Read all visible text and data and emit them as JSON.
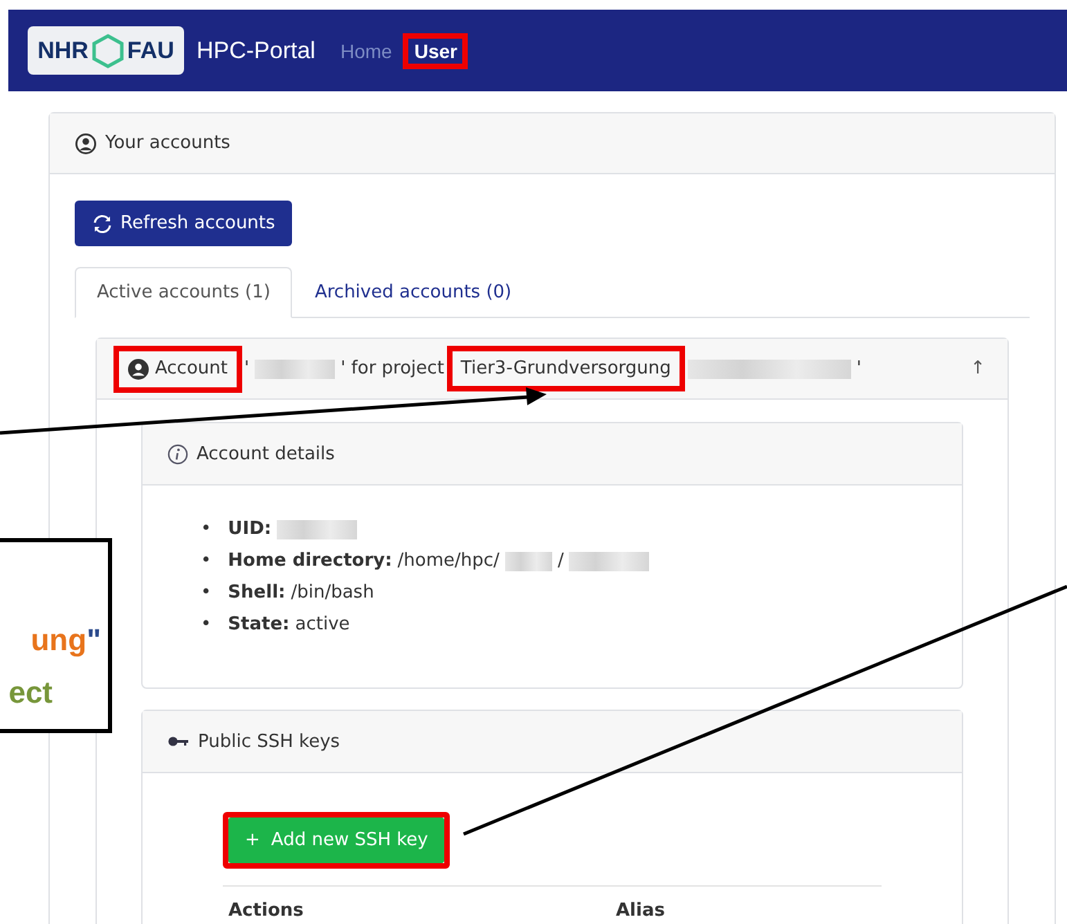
{
  "navbar": {
    "logo": {
      "left": "NHR",
      "right": "FAU"
    },
    "brand": "HPC-Portal",
    "links": [
      {
        "label": "Home",
        "selected": false,
        "kind": "link"
      },
      {
        "label": "User",
        "selected": true,
        "kind": "boxed"
      }
    ]
  },
  "accounts_card": {
    "title": "Your accounts",
    "refresh_button": "Refresh accounts",
    "tabs": [
      {
        "label": "Active accounts (1)",
        "selected": true
      },
      {
        "label": "Archived accounts (0)",
        "selected": false
      }
    ],
    "account": {
      "header": [
        {
          "kind": "boxed",
          "text": "Account"
        },
        {
          "kind": "text",
          "text": "'"
        },
        {
          "kind": "blur"
        },
        {
          "kind": "text",
          "text": "' for project"
        },
        {
          "kind": "boxed",
          "text": "Tier3-Grundversorgung"
        },
        {
          "kind": "blur"
        },
        {
          "kind": "text",
          "text": "'"
        }
      ],
      "toggle": "↑",
      "details": {
        "title": "Account details",
        "items": [
          {
            "bullet": "•",
            "label": "UID:",
            "value": [
              {
                "kind": "blur"
              }
            ]
          },
          {
            "bullet": "•",
            "label": "Home directory:",
            "value": [
              {
                "kind": "text",
                "text": "/home/hpc/"
              },
              {
                "kind": "blur"
              },
              {
                "kind": "text",
                "text": "/"
              },
              {
                "kind": "blur"
              }
            ]
          },
          {
            "bullet": "•",
            "label": "Shell:",
            "value": [
              {
                "kind": "text",
                "text": "/bin/bash"
              }
            ]
          },
          {
            "bullet": "•",
            "label": "State:",
            "value": [
              {
                "kind": "text",
                "text": "active"
              }
            ]
          }
        ]
      },
      "ssh_keys": {
        "title": "Public SSH keys",
        "add_button": {
          "icon": "+",
          "label": "Add new SSH key",
          "highlighted": true
        },
        "columns": [
          "Actions",
          "Alias"
        ]
      }
    }
  },
  "callout": {
    "lines": [
      [
        {
          "text": "ung",
          "color": "#e8741c"
        },
        {
          "text": "\"",
          "color": "#2b4a8c"
        }
      ],
      [
        {
          "text": "ect",
          "color": "#77963a"
        }
      ]
    ]
  }
}
